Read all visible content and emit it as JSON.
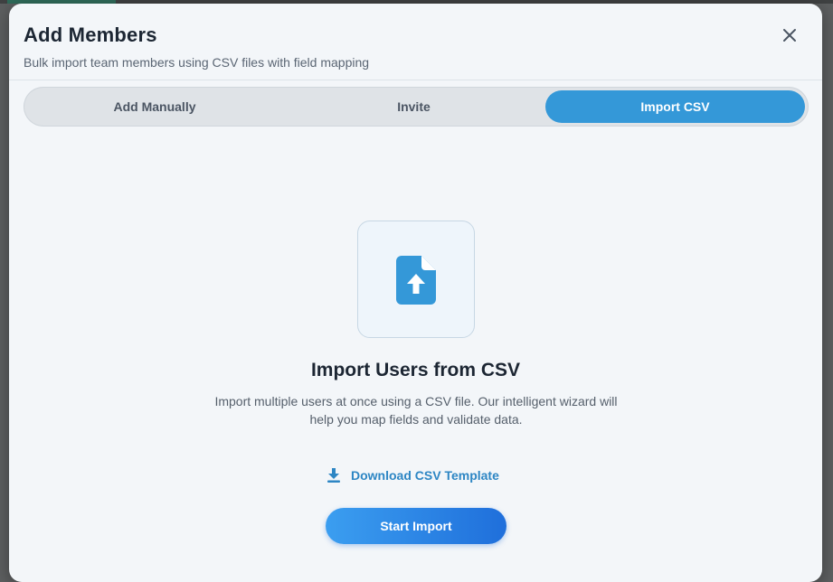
{
  "dialog": {
    "title": "Add Members",
    "subtitle": "Bulk import team members using CSV files with field mapping",
    "close_icon": "close-icon"
  },
  "tabs": [
    {
      "label": "Add Manually",
      "active": false
    },
    {
      "label": "Invite",
      "active": false
    },
    {
      "label": "Import CSV",
      "active": true
    }
  ],
  "import": {
    "icon": "file-upload-icon",
    "heading": "Import Users from CSV",
    "description_line1": "Import multiple users at once using a CSV file. Our intelligent wizard will",
    "description_line2": "help you map fields and validate data.",
    "download_icon": "download-icon",
    "download_label": "Download CSV Template",
    "start_label": "Start Import"
  },
  "colors": {
    "accent": "#3498d8",
    "button_gradient_start": "#3b9ef0",
    "button_gradient_end": "#1f6fdb",
    "modal_bg": "#f3f6f9"
  }
}
